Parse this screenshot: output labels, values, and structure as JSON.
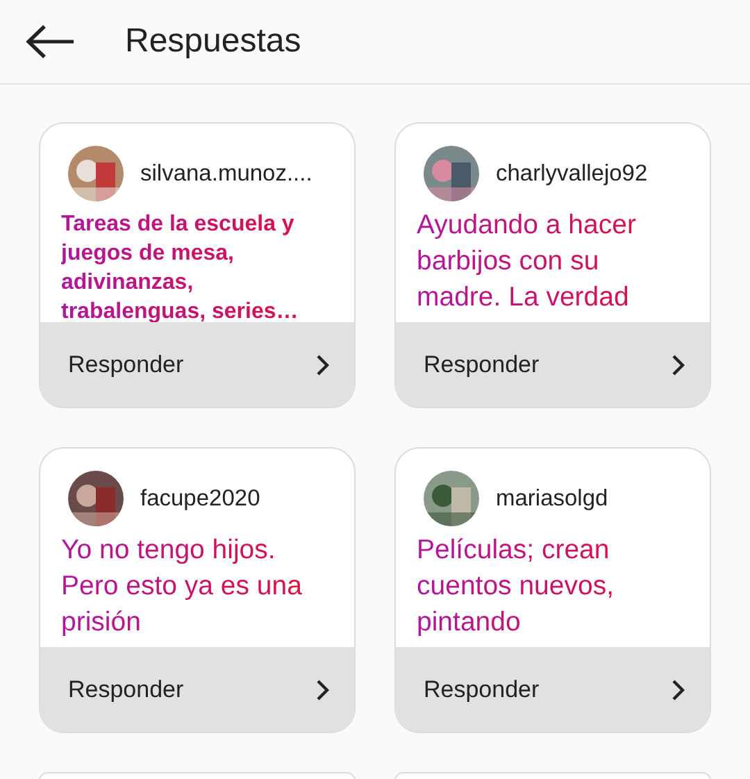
{
  "header": {
    "title": "Respuestas"
  },
  "responses": [
    {
      "username": "silvana.munoz....",
      "text": "Tareas de la escuela y juegos de mesa, adivinanzas, trabalenguas, series…",
      "kind": "compact",
      "reply": "Responder"
    },
    {
      "username": "charlyvallejo92",
      "text": "Ayudando a hacer barbijos con su madre. La verdad",
      "kind": "regular",
      "reply": "Responder"
    },
    {
      "username": "facupe2020",
      "text": "Yo no tengo hijos. Pero esto ya es una prisión",
      "kind": "regular",
      "reply": "Responder"
    },
    {
      "username": "mariasolgd",
      "text": "Películas; crean cuentos nuevos, pintando",
      "kind": "regular",
      "reply": "Responder"
    }
  ]
}
